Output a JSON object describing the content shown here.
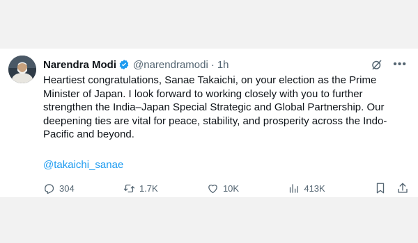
{
  "tweet": {
    "author_name": "Narendra Modi",
    "handle": "@narendramodi",
    "separator": "·",
    "time": "1h",
    "text": "Heartiest congratulations, Sanae Takaichi, on your election as the Prime Minister of Japan. I look forward to working closely with you to further strengthen the India–Japan Special Strategic and Global Partnership. Our deepening ties are vital for peace, stability, and prosperity across the Indo-Pacific and beyond.",
    "mention": "@takaichi_sanae"
  },
  "icons": {
    "verified": "verified-badge-icon",
    "grok": "grok-icon",
    "more": "more-icon",
    "reply": "reply-icon",
    "repost": "repost-icon",
    "like": "like-icon",
    "views": "views-icon",
    "bookmark": "bookmark-icon",
    "share": "share-icon"
  },
  "stats": {
    "replies": "304",
    "reposts": "1.7K",
    "likes": "10K",
    "views": "413K"
  },
  "colors": {
    "link": "#1d9bf0",
    "muted": "#536471",
    "text": "#0f1419",
    "verified": "#1d9bf0"
  }
}
